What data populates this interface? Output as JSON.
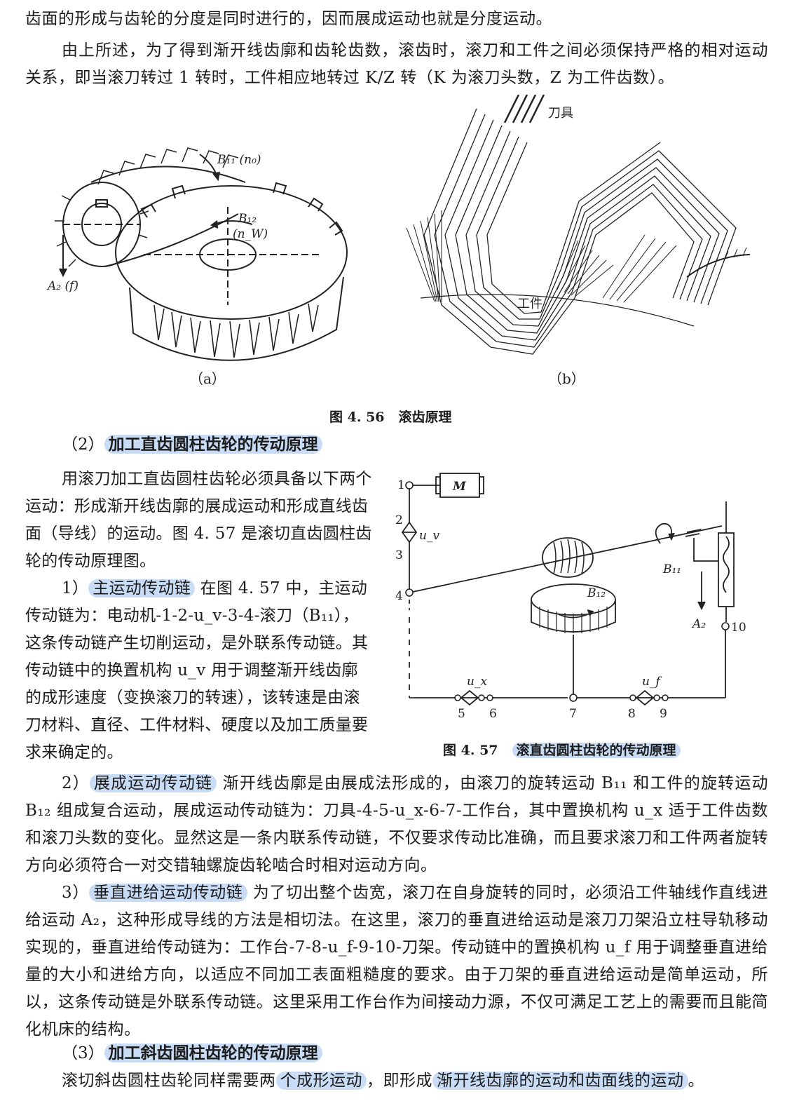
{
  "top": {
    "line1": "齿面的形成与齿轮的分度是同时进行的，因而展成运动也就是分度运动。",
    "para2": "由上所述，为了得到渐开线齿廓和齿轮齿数，滚齿时，滚刀和工件之间必须保持严格的相对运动关系，即当滚刀转过 1 转时，工件相应地转过 K/Z 转（K 为滚刀头数，Z 为工件齿数）。"
  },
  "fig456": {
    "a_labels": {
      "b11": "B₁₁ (n₀)",
      "b12": "B₁₂",
      "nw": "(n_W)",
      "a2": "A₂ (f)"
    },
    "b_labels": {
      "tool": "刀具",
      "work": "工件"
    },
    "sub_a": "（a）",
    "sub_b": "（b）",
    "caption_num": "图 4. 56",
    "caption_text": "滚齿原理"
  },
  "section2": {
    "prefix": "（2）",
    "title": "加工直齿圆柱齿轮的传动原理"
  },
  "intro": "用滚刀加工直齿圆柱齿轮必须具备以下两个运动：形成渐开线齿廓的展成运动和形成直线齿面（导线）的运动。图 4. 57 是滚切直齿圆柱齿轮的传动原理图。",
  "item1": {
    "prefix": "1）",
    "title": "主运动传动链",
    "body": "在图 4. 57 中，主运动传动链为：电动机-1-2-u_v-3-4-滚刀（B₁₁），这条传动链产生切削运动，是外联系传动链。其传动链中的换置机构 u_v 用于调整渐开线齿廓的成形速度（变换滚刀的转速），该转速是由滚刀材料、直径、工件材料、硬度以及加工质量要求来确定的。"
  },
  "fig457": {
    "labels": {
      "motor": "M",
      "uv": "u_v",
      "ux": "u_x",
      "uf": "u_f",
      "b11": "B₁₁",
      "b12": "B₁₂",
      "a2": "A₂",
      "n1": "1",
      "n2": "2",
      "n3": "3",
      "n4": "4",
      "n5": "5",
      "n6": "6",
      "n7": "7",
      "n8": "8",
      "n9": "9",
      "n10": "10"
    },
    "caption_num": "图 4. 57",
    "caption_text": "滚直齿圆柱齿轮的传动原理"
  },
  "item2": {
    "prefix": "2）",
    "title": "展成运动传动链",
    "body": "渐开线齿廓是由展成法形成的，由滚刀的旋转运动 B₁₁ 和工件的旋转运动 B₁₂ 组成复合运动，展成运动传动链为：刀具-4-5-u_x-6-7-工作台，其中置换机构 u_x 适于工件齿数和滚刀头数的变化。显然这是一条内联系传动链，不仅要求传动比准确，而且要求滚刀和工件两者旋转方向必须符合一对交错轴螺旋齿轮啮合时相对运动方向。"
  },
  "item3": {
    "prefix": "3）",
    "title": "垂直进给运动传动链",
    "body": "为了切出整个齿宽，滚刀在自身旋转的同时，必须沿工件轴线作直线进给运动 A₂，这种形成导线的方法是相切法。在这里，滚刀的垂直进给运动是滚刀刀架沿立柱导轨移动实现的，垂直进给传动链为：工作台-7-8-u_f-9-10-刀架。传动链中的置换机构 u_f 用于调整垂直进给量的大小和进给方向，以适应不同加工表面粗糙度的要求。由于刀架的垂直进给运动是简单运动，所以，这条传动链是外联系传动链。这里采用工作台作为间接动力源，不仅可满足工艺上的需要而且能简化机床的结构。"
  },
  "section3": {
    "prefix": "（3）",
    "title": "加工斜齿圆柱齿轮的传动原理"
  },
  "last": {
    "pre": "滚切斜齿圆柱齿轮同样需要两",
    "hl1": "个成形运动",
    "mid": "，即形成",
    "hl2": "渐开线齿廓的运动和齿面线的运动",
    "post": "。"
  }
}
